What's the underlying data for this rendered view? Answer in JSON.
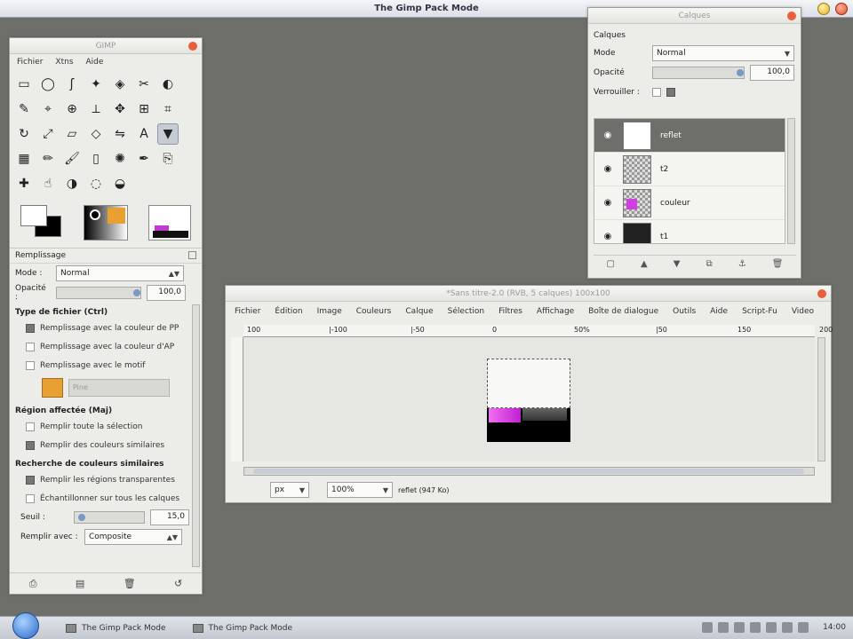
{
  "topbar": {
    "title": "The Gimp Pack Mode"
  },
  "toolbox": {
    "title": "GIMP",
    "menu": [
      "Fichier",
      "Xtns",
      "Aide"
    ],
    "tool_icons": [
      "rect-select",
      "ellipse-select",
      "free-select",
      "fuzzy-select",
      "color-select",
      "scissors",
      "foreground-select",
      "paths",
      "color-picker",
      "zoom",
      "measure",
      "move",
      "align",
      "crop",
      "rotate",
      "scale",
      "shear",
      "perspective",
      "flip",
      "text",
      "bucket-fill",
      "blend",
      "pencil",
      "paintbrush",
      "eraser",
      "airbrush",
      "ink",
      "clone",
      "heal",
      "smudge",
      "dodge",
      "blur",
      "burn"
    ],
    "options": {
      "panel_title": "Remplissage",
      "mode_label": "Mode :",
      "mode_value": "Normal",
      "opacity_label": "Opacité :",
      "opacity_value": "100,0",
      "fill_type_title": "Type de fichier (Ctrl)",
      "fill_types": [
        "Remplissage avec la couleur de PP",
        "Remplissage avec la couleur d'AP",
        "Remplissage avec le motif"
      ],
      "pattern_name": "Pine",
      "area_title": "Région affectée (Maj)",
      "areas": [
        "Remplir toute la sélection",
        "Remplir des couleurs similaires"
      ],
      "similar_title": "Recherche de couleurs similaires",
      "similar_opts": [
        "Remplir les régions transparentes",
        "Échantillonner sur tous les calques"
      ],
      "threshold_label": "Seuil :",
      "threshold_value": "15,0",
      "fillby_label": "Remplir avec :",
      "fillby_value": "Composite"
    }
  },
  "layers": {
    "title": "Calques",
    "tab_label": "Calques",
    "mode_label": "Mode",
    "mode_value": "Normal",
    "opacity_label": "Opacité",
    "opacity_value": "100,0",
    "lock_label": "Verrouiller :",
    "items": [
      {
        "name": "reflet"
      },
      {
        "name": "t2"
      },
      {
        "name": "couleur"
      },
      {
        "name": "t1"
      }
    ]
  },
  "image_window": {
    "title": "*Sans titre-2.0 (RVB, 5 calques) 100x100",
    "menu": [
      "Fichier",
      "Édition",
      "Image",
      "Couleurs",
      "Calque",
      "Sélection",
      "Filtres",
      "Affichage",
      "Boîte de dialogue",
      "Outils",
      "Aide",
      "Script-Fu",
      "Video"
    ],
    "ruler_ticks": [
      "100",
      "|-100",
      "|-50",
      "0",
      "50%",
      "|50",
      "150",
      "200"
    ],
    "unit": "px",
    "zoom": "100%",
    "status": "reflet (947 Ko)"
  },
  "taskbar": {
    "tasks": [
      "The Gimp Pack Mode",
      "The Gimp Pack Mode"
    ],
    "clock": "14:00"
  }
}
